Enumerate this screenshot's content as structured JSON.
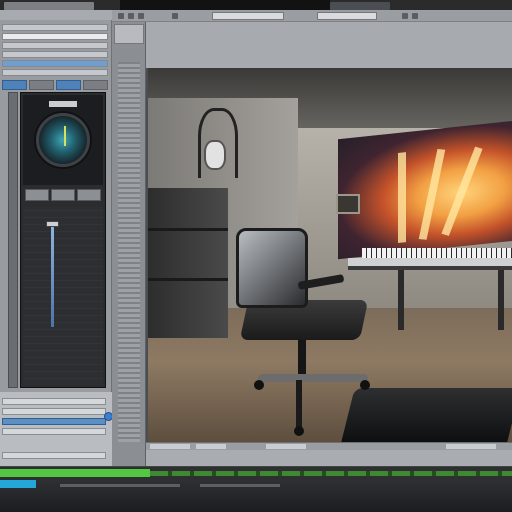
{
  "app": {
    "vertical_label": "▮▮▮▮▮▮▮▮▮▮▮▮▮▮▮▮"
  },
  "viewport": {
    "scene": "studio-room-render"
  },
  "colors": {
    "panel": "#a7aaae",
    "accent_blue": "#4f82b8",
    "timeline_green": "#53c642",
    "timeline_cyan": "#22a7d8",
    "dark": "#1a1a1a"
  },
  "icons": {
    "meter": "dial-icon",
    "fader": "fader-icon"
  }
}
